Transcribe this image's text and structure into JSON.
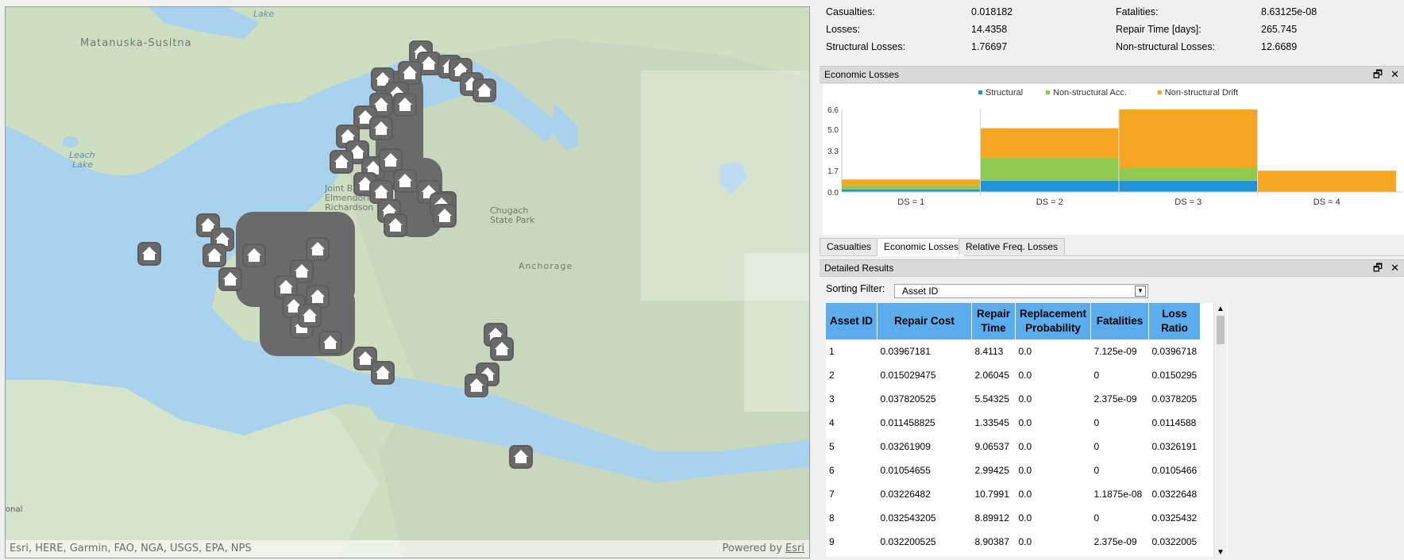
{
  "summary": {
    "casualties_label": "Casualties:",
    "casualties_value": "0.018182",
    "fatalities_label": "Fatalities:",
    "fatalities_value": "8.63125e-08",
    "losses_label": "Losses:",
    "losses_value": "14.4358",
    "repair_label": "Repair Time [days]:",
    "repair_value": "265.745",
    "structural_label": "Structural Losses:",
    "structural_value": "1.76697",
    "nonstructural_label": "Non-structural Losses:",
    "nonstructural_value": "12.6689"
  },
  "economic_panel": {
    "title": "Economic Losses",
    "restore_icon": "restore-icon",
    "close_icon": "close-icon"
  },
  "detailed_panel": {
    "title": "Detailed Results",
    "restore_icon": "restore-icon",
    "close_icon": "close-icon"
  },
  "chart_data": {
    "type": "bar",
    "stacked": true,
    "categories": [
      "DS = 1",
      "DS = 2",
      "DS = 3",
      "DS = 4"
    ],
    "series": [
      {
        "name": "Structural",
        "color": "#1f95d6",
        "values": [
          0.2,
          0.9,
          0.9,
          0.0
        ]
      },
      {
        "name": "Non-structural Acc.",
        "color": "#8fc94f",
        "values": [
          0.3,
          1.8,
          1.0,
          0.0
        ]
      },
      {
        "name": "Non-structural Drift",
        "color": "#f5a623",
        "values": [
          0.5,
          2.4,
          4.7,
          1.7
        ]
      }
    ],
    "ylim": [
      0,
      6.6
    ],
    "yticks": [
      "0.0",
      "1.7",
      "3.3",
      "5.0",
      "6.6"
    ],
    "legend": "top",
    "grid": false
  },
  "tabs": [
    {
      "label": "Casualties",
      "active": false
    },
    {
      "label": "Economic Losses",
      "active": true
    },
    {
      "label": "Relative Freq. Losses",
      "active": false
    }
  ],
  "filter": {
    "label": "Sorting Filter:",
    "value": "Asset ID"
  },
  "table": {
    "headers": [
      "Asset ID",
      "Repair Cost",
      "Repair Time",
      "Replacement Probability",
      "Fatalities",
      "Loss Ratio"
    ],
    "rows": [
      [
        "1",
        "0.03967181",
        "8.4113",
        "0.0",
        "7.125e-09",
        "0.0396718"
      ],
      [
        "2",
        "0.015029475",
        "2.06045",
        "0.0",
        "0",
        "0.0150295"
      ],
      [
        "3",
        "0.037820525",
        "5.54325",
        "0.0",
        "2.375e-09",
        "0.0378205"
      ],
      [
        "4",
        "0.011458825",
        "1.33545",
        "0.0",
        "0",
        "0.0114588"
      ],
      [
        "5",
        "0.03261909",
        "9.06537",
        "0.0",
        "0",
        "0.0326191"
      ],
      [
        "6",
        "0.01054655",
        "2.99425",
        "0.0",
        "0",
        "0.0105466"
      ],
      [
        "7",
        "0.03226482",
        "10.7991",
        "0.0",
        "1.1875e-08",
        "0.0322648"
      ],
      [
        "8",
        "0.032543205",
        "8.89912",
        "0.0",
        "0",
        "0.0325432"
      ],
      [
        "9",
        "0.032200525",
        "8.90387",
        "0.0",
        "2.375e-09",
        "0.0322005"
      ]
    ]
  },
  "map": {
    "labels": {
      "matanuska": "Matanuska-Susitna",
      "lake_top": "Lake",
      "leach": "Leach",
      "leach2": "Lake",
      "jber1": "Joint Base",
      "jber2": "Elmendorf",
      "jber3": "Richardson",
      "chugach1": "Chugach",
      "chugach2": "State Park",
      "anchorage": "Anchorage",
      "onal": "onal"
    },
    "attribution": "Esri, HERE, Garmin, FAO, NGA, USGS, EPA, NPS",
    "powered_by": "Powered by",
    "esri_link": "Esri"
  }
}
